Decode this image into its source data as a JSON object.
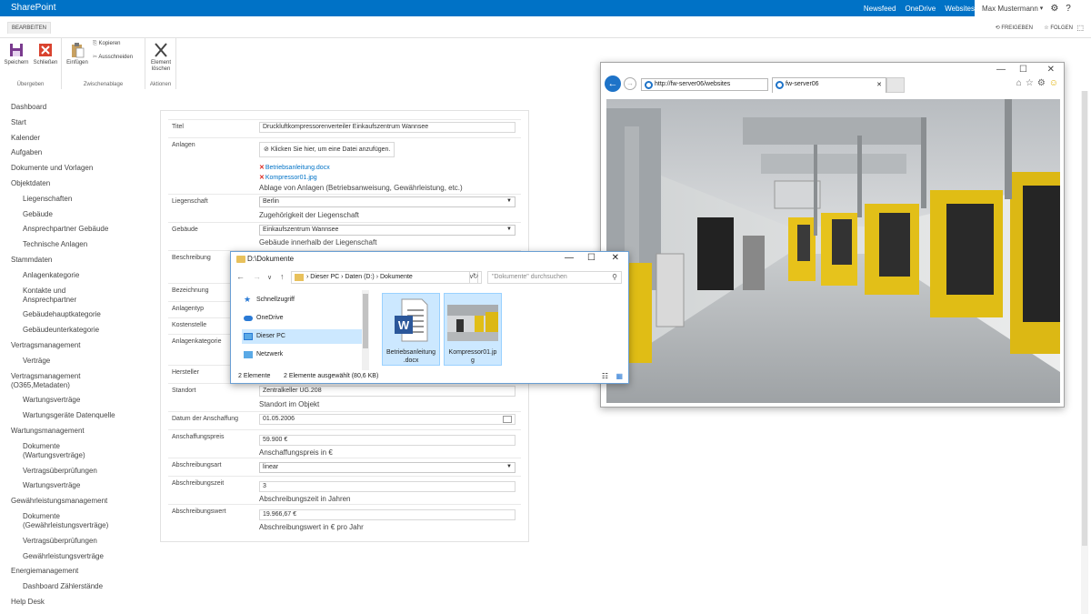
{
  "suite": {
    "brand": "SharePoint",
    "links": [
      "Newsfeed",
      "OneDrive",
      "Websites"
    ],
    "user": "Max Mustermann",
    "user_chevron": "▾"
  },
  "ribbon": {
    "tab": "BEARBEITEN",
    "share": "FREIGEBEN",
    "follow": "FOLGEN",
    "groups": {
      "commit": {
        "save": "Speichern",
        "close": "Schließen",
        "label": "Übergeben"
      },
      "clipboard": {
        "paste": "Einfügen",
        "copy": "Kopieren",
        "cut": "Ausschneiden",
        "label": "Zwischenablage"
      },
      "actions": {
        "delete_line1": "Element",
        "delete_line2": "löschen",
        "label": "Aktionen"
      }
    }
  },
  "nav": [
    {
      "label": "Dashboard",
      "sub": false
    },
    {
      "label": "Start",
      "sub": false
    },
    {
      "label": "Kalender",
      "sub": false
    },
    {
      "label": "Aufgaben",
      "sub": false
    },
    {
      "label": "Dokumente und Vorlagen",
      "sub": false
    },
    {
      "label": "Objektdaten",
      "sub": false
    },
    {
      "label": "Liegenschaften",
      "sub": true
    },
    {
      "label": "Gebäude",
      "sub": true
    },
    {
      "label": "Ansprechpartner Gebäude",
      "sub": true
    },
    {
      "label": "Technische Anlagen",
      "sub": true
    },
    {
      "label": "Stammdaten",
      "sub": false
    },
    {
      "label": "Anlagenkategorie",
      "sub": true
    },
    {
      "label": "Kontakte und Ansprechpartner",
      "sub": true,
      "lines": 2
    },
    {
      "label": "Gebäudehauptkategorie",
      "sub": true
    },
    {
      "label": "Gebäudeunterkategorie",
      "sub": true
    },
    {
      "label": "Vertragsmanagement",
      "sub": false
    },
    {
      "label": "Verträge",
      "sub": true
    },
    {
      "label": "Vertragsmanagement (O365,Metadaten)",
      "sub": false,
      "lines": 2
    },
    {
      "label": "Wartungsverträge",
      "sub": true
    },
    {
      "label": "Wartungsgeräte Datenquelle",
      "sub": true
    },
    {
      "label": "Wartungsmanagement",
      "sub": false
    },
    {
      "label": "Dokumente (Wartungsverträge)",
      "sub": true,
      "lines": 2
    },
    {
      "label": "Vertragsüberprüfungen",
      "sub": true
    },
    {
      "label": "Wartungsverträge",
      "sub": true
    },
    {
      "label": "Gewährleistungsmanagement",
      "sub": false
    },
    {
      "label": "Dokumente (Gewährleistungsverträge)",
      "sub": true,
      "lines": 2
    },
    {
      "label": "Vertragsüberprüfungen",
      "sub": true
    },
    {
      "label": "Gewährleistungsverträge",
      "sub": true
    },
    {
      "label": "Energiemanagement",
      "sub": false
    },
    {
      "label": "Dashboard Zählerstände",
      "sub": true
    },
    {
      "label": "Help Desk",
      "sub": false
    }
  ],
  "form": {
    "titel": {
      "label": "Titel",
      "value": "Druckluftkompressorenverteiler Einkaufszentrum Wannsee"
    },
    "anlagen": {
      "label": "Anlagen",
      "attach_button": "Klicken Sie hier, um eine Datei anzufügen.",
      "files": [
        "Betriebsanleitung.docx",
        "Kompressor01.jpg"
      ],
      "hint": "Ablage von Anlagen (Betriebsanweisung, Gewährleistung, etc.)"
    },
    "liegenschaft": {
      "label": "Liegenschaft",
      "value": "Berlin",
      "hint": "Zugehörigkeit der Liegenschaft"
    },
    "gebaeude": {
      "label": "Gebäude",
      "value": "Einkaufszentrum Wannsee",
      "hint": "Gebäude innerhalb der Liegenschaft"
    },
    "beschreibung": {
      "label": "Beschreibung"
    },
    "bezeichnung": {
      "label": "Bezeichnung"
    },
    "anlagentyp": {
      "label": "Anlagentyp"
    },
    "kostenstelle": {
      "label": "Kostenstelle"
    },
    "anlagenkategorie": {
      "label": "Anlagenkategorie"
    },
    "hersteller": {
      "label": "Hersteller"
    },
    "standort": {
      "label": "Standort",
      "value": "Zentralkeller UG.208",
      "hint": "Standort im Objekt"
    },
    "anschaffung": {
      "label": "Datum der Anschaffung",
      "value": "01.05.2006"
    },
    "preis": {
      "label": "Anschaffungspreis",
      "value": "59.900 €",
      "hint": "Anschaffungspreis in €"
    },
    "abschreibungsart": {
      "label": "Abschreibungsart",
      "value": "linear"
    },
    "abschreibungszeit": {
      "label": "Abschreibungszeit",
      "value": "3",
      "hint": "Abschreibungszeit in Jahren"
    },
    "abschreibungswert": {
      "label": "Abschreibungswert",
      "value": "19.966,67 €",
      "hint": "Abschreibungswert in € pro Jahr"
    }
  },
  "explorer": {
    "title": "D:\\Dokumente",
    "path": [
      "Dieser PC",
      "Daten (D:)",
      "Dokumente"
    ],
    "path_sep": "›",
    "search_placeholder": "\"Dokumente\" durchsuchen",
    "sidebar": [
      "Schnellzugriff",
      "OneDrive",
      "Dieser PC",
      "Netzwerk"
    ],
    "files": [
      {
        "line1": "Betriebsanleitung",
        "line2": ".docx"
      },
      {
        "line1": "Kompressor01.jp",
        "line2": "g"
      }
    ],
    "status_count": "2 Elemente",
    "status_selected": "2 Elemente ausgewählt (80,6 KB)"
  },
  "browser": {
    "address": "http://fw-server06/websites",
    "tab_title": "fw-server06"
  },
  "colors": {
    "suitebar": "#0072c6",
    "selection": "#cce8ff",
    "delete_red": "#d9261c"
  }
}
